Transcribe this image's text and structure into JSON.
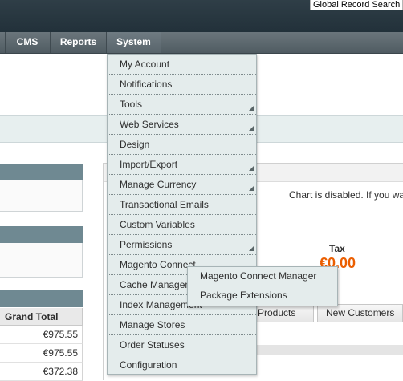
{
  "header": {
    "search_placeholder": "Global Record Search"
  },
  "nav": [
    {
      "label": "CMS",
      "active": false
    },
    {
      "label": "Reports",
      "active": false
    },
    {
      "label": "System",
      "active": true
    }
  ],
  "system_menu": [
    {
      "label": "My Account",
      "has_submenu": false
    },
    {
      "label": "Notifications",
      "has_submenu": false
    },
    {
      "label": "Tools",
      "has_submenu": true
    },
    {
      "label": "Web Services",
      "has_submenu": true
    },
    {
      "label": "Design",
      "has_submenu": false
    },
    {
      "label": "Import/Export",
      "has_submenu": true
    },
    {
      "label": "Manage Currency",
      "has_submenu": true
    },
    {
      "label": "Transactional Emails",
      "has_submenu": false
    },
    {
      "label": "Custom Variables",
      "has_submenu": false
    },
    {
      "label": "Permissions",
      "has_submenu": true
    },
    {
      "label": "Magento Connect",
      "has_submenu": true
    },
    {
      "label": "Cache Management",
      "has_submenu": false
    },
    {
      "label": "Index Management",
      "has_submenu": false
    },
    {
      "label": "Manage Stores",
      "has_submenu": false
    },
    {
      "label": "Order Statuses",
      "has_submenu": false
    },
    {
      "label": "Configuration",
      "has_submenu": false
    }
  ],
  "connect_submenu": [
    "Magento Connect Manager",
    "Package Extensions"
  ],
  "dashboard": {
    "chart_message": "Chart is disabled. If you wa",
    "tax_label": "Tax",
    "tax_value": "€0.00",
    "tabs": [
      "d Products",
      "New Customers"
    ],
    "grand_total_header": "Grand Total",
    "grand_totals": [
      "€975.55",
      "€975.55",
      "€372.38"
    ]
  },
  "colors": {
    "accent_orange": "#eb5e00",
    "menu_bg": "#e4ecec",
    "nav_bg": "#58646b"
  }
}
